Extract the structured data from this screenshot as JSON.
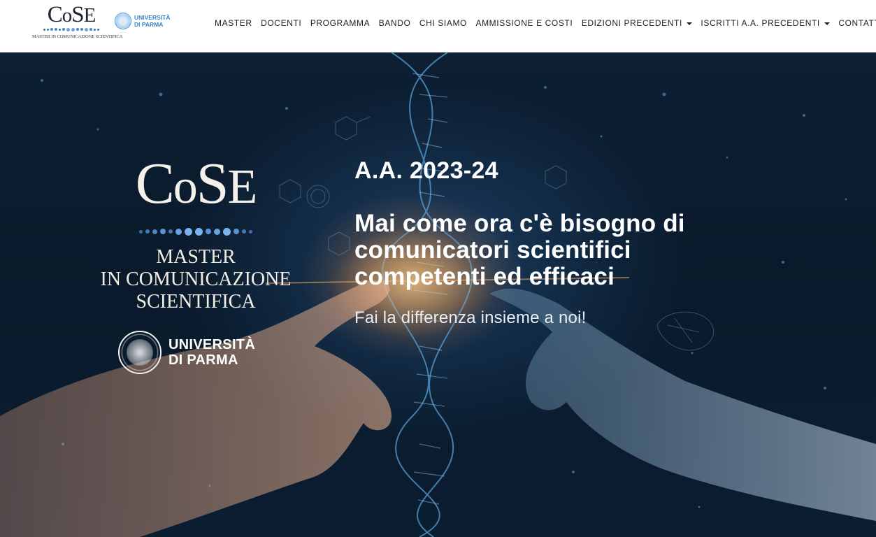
{
  "header": {
    "logo": {
      "wordmark_c": "C",
      "wordmark_o": "o",
      "wordmark_s": "S",
      "wordmark_e": "E",
      "subtitle": "MASTER IN COMUNICAZIONE SCIENTIFICA"
    },
    "unipr": {
      "line1": "UNIVERSITÀ",
      "line2": "DI PARMA"
    },
    "nav": [
      {
        "label": "MASTER",
        "dropdown": false
      },
      {
        "label": "DOCENTI",
        "dropdown": false
      },
      {
        "label": "PROGRAMMA",
        "dropdown": false
      },
      {
        "label": "BANDO",
        "dropdown": false
      },
      {
        "label": "CHI SIAMO",
        "dropdown": false
      },
      {
        "label": "AMMISSIONE E COSTI",
        "dropdown": false
      },
      {
        "label": "EDIZIONI PRECEDENTI",
        "dropdown": true
      },
      {
        "label": "ISCRITTI A.A. PRECEDENTI",
        "dropdown": true
      },
      {
        "label": "CONTATTI",
        "dropdown": false
      }
    ]
  },
  "hero": {
    "logo": {
      "wordmark_c": "C",
      "wordmark_o": "o",
      "wordmark_s": "S",
      "wordmark_e": "E",
      "line1": "MASTER",
      "line2": "IN COMUNICAZIONE",
      "line3": "SCIENTIFICA"
    },
    "unipr": {
      "line1": "UNIVERSITÀ",
      "line2": "DI PARMA"
    },
    "year": "A.A. 2023-24",
    "headline": "Mai come ora c'è bisogno di comunicatori scientifici competenti ed efficaci",
    "tagline": "Fai la differenza insieme a noi!"
  },
  "colors": {
    "header_bg": "#ffffff",
    "nav_text": "#222222",
    "hero_bg": "#0b1a2c",
    "hero_text": "#ffffff",
    "logo_dot": "#4d86c9"
  },
  "icons": [
    "caret-down-icon",
    "university-seal-icon",
    "dna-helix-graphic"
  ]
}
